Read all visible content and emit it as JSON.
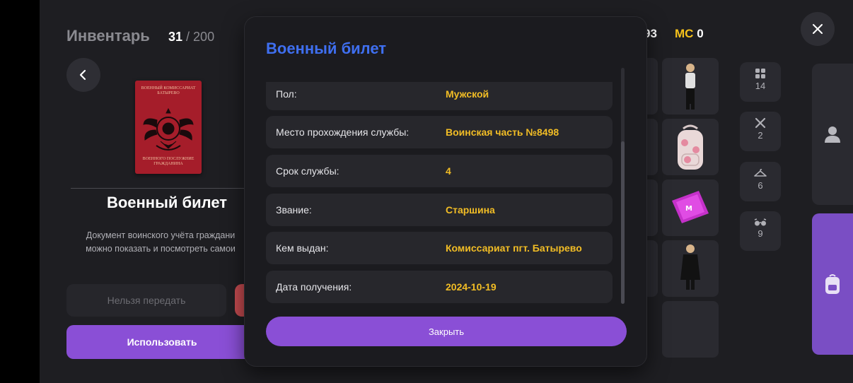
{
  "inventory": {
    "title": "Инвентарь",
    "count": "31",
    "max": "/ 200"
  },
  "item": {
    "name": "Военный билет",
    "passport_text_top": "ВОЕННЫЙ КОМИССАРИАТ БАТЫРЕВО",
    "passport_text_bottom": "ВОЕННОГО ПОСЛУЖНИЕ ГРАЖДАНИНА",
    "description_line1": "Документ воинского учёта граждани",
    "description_line2": "можно показать и посмотреть самои",
    "transfer_label": "Нельзя передать",
    "use_label": "Использовать"
  },
  "status": {
    "money": "93",
    "mc_label": "MC",
    "mc_value": "0"
  },
  "categories": [
    {
      "icon": "grid-icon",
      "count": "14"
    },
    {
      "icon": "tools-icon",
      "count": "2"
    },
    {
      "icon": "hanger-icon",
      "count": "6"
    },
    {
      "icon": "glasses-icon",
      "count": "9"
    }
  ],
  "modal": {
    "title": "Военный билет",
    "rows": [
      {
        "label": "Пол:",
        "value": "Мужской"
      },
      {
        "label": "Место прохождения службы:",
        "value": "Воинская часть №8498"
      },
      {
        "label": "Срок службы:",
        "value": "4"
      },
      {
        "label": "Звание:",
        "value": "Старшина"
      },
      {
        "label": "Кем выдан:",
        "value": "Комиссариат пгт. Батырево"
      },
      {
        "label": "Дата получения:",
        "value": "2024-10-19"
      }
    ],
    "close_label": "Закрыть"
  },
  "colors": {
    "accent_purple": "#8a4fd6",
    "title_blue": "#3f6ff0",
    "value_gold": "#f2bd25",
    "danger_red": "#c24a4f"
  }
}
